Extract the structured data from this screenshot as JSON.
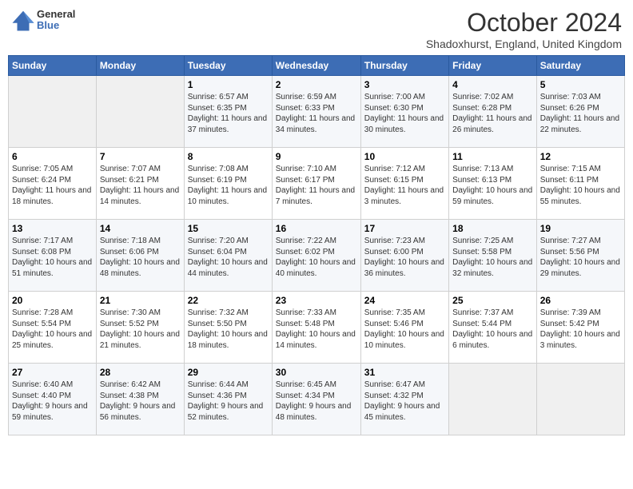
{
  "header": {
    "logo_line1": "General",
    "logo_line2": "Blue",
    "month": "October 2024",
    "location": "Shadoxhurst, England, United Kingdom"
  },
  "days_of_week": [
    "Sunday",
    "Monday",
    "Tuesday",
    "Wednesday",
    "Thursday",
    "Friday",
    "Saturday"
  ],
  "weeks": [
    [
      {
        "day": null,
        "content": ""
      },
      {
        "day": null,
        "content": ""
      },
      {
        "day": 1,
        "content": "Sunrise: 6:57 AM\nSunset: 6:35 PM\nDaylight: 11 hours and 37 minutes."
      },
      {
        "day": 2,
        "content": "Sunrise: 6:59 AM\nSunset: 6:33 PM\nDaylight: 11 hours and 34 minutes."
      },
      {
        "day": 3,
        "content": "Sunrise: 7:00 AM\nSunset: 6:30 PM\nDaylight: 11 hours and 30 minutes."
      },
      {
        "day": 4,
        "content": "Sunrise: 7:02 AM\nSunset: 6:28 PM\nDaylight: 11 hours and 26 minutes."
      },
      {
        "day": 5,
        "content": "Sunrise: 7:03 AM\nSunset: 6:26 PM\nDaylight: 11 hours and 22 minutes."
      }
    ],
    [
      {
        "day": 6,
        "content": "Sunrise: 7:05 AM\nSunset: 6:24 PM\nDaylight: 11 hours and 18 minutes."
      },
      {
        "day": 7,
        "content": "Sunrise: 7:07 AM\nSunset: 6:21 PM\nDaylight: 11 hours and 14 minutes."
      },
      {
        "day": 8,
        "content": "Sunrise: 7:08 AM\nSunset: 6:19 PM\nDaylight: 11 hours and 10 minutes."
      },
      {
        "day": 9,
        "content": "Sunrise: 7:10 AM\nSunset: 6:17 PM\nDaylight: 11 hours and 7 minutes."
      },
      {
        "day": 10,
        "content": "Sunrise: 7:12 AM\nSunset: 6:15 PM\nDaylight: 11 hours and 3 minutes."
      },
      {
        "day": 11,
        "content": "Sunrise: 7:13 AM\nSunset: 6:13 PM\nDaylight: 10 hours and 59 minutes."
      },
      {
        "day": 12,
        "content": "Sunrise: 7:15 AM\nSunset: 6:11 PM\nDaylight: 10 hours and 55 minutes."
      }
    ],
    [
      {
        "day": 13,
        "content": "Sunrise: 7:17 AM\nSunset: 6:08 PM\nDaylight: 10 hours and 51 minutes."
      },
      {
        "day": 14,
        "content": "Sunrise: 7:18 AM\nSunset: 6:06 PM\nDaylight: 10 hours and 48 minutes."
      },
      {
        "day": 15,
        "content": "Sunrise: 7:20 AM\nSunset: 6:04 PM\nDaylight: 10 hours and 44 minutes."
      },
      {
        "day": 16,
        "content": "Sunrise: 7:22 AM\nSunset: 6:02 PM\nDaylight: 10 hours and 40 minutes."
      },
      {
        "day": 17,
        "content": "Sunrise: 7:23 AM\nSunset: 6:00 PM\nDaylight: 10 hours and 36 minutes."
      },
      {
        "day": 18,
        "content": "Sunrise: 7:25 AM\nSunset: 5:58 PM\nDaylight: 10 hours and 32 minutes."
      },
      {
        "day": 19,
        "content": "Sunrise: 7:27 AM\nSunset: 5:56 PM\nDaylight: 10 hours and 29 minutes."
      }
    ],
    [
      {
        "day": 20,
        "content": "Sunrise: 7:28 AM\nSunset: 5:54 PM\nDaylight: 10 hours and 25 minutes."
      },
      {
        "day": 21,
        "content": "Sunrise: 7:30 AM\nSunset: 5:52 PM\nDaylight: 10 hours and 21 minutes."
      },
      {
        "day": 22,
        "content": "Sunrise: 7:32 AM\nSunset: 5:50 PM\nDaylight: 10 hours and 18 minutes."
      },
      {
        "day": 23,
        "content": "Sunrise: 7:33 AM\nSunset: 5:48 PM\nDaylight: 10 hours and 14 minutes."
      },
      {
        "day": 24,
        "content": "Sunrise: 7:35 AM\nSunset: 5:46 PM\nDaylight: 10 hours and 10 minutes."
      },
      {
        "day": 25,
        "content": "Sunrise: 7:37 AM\nSunset: 5:44 PM\nDaylight: 10 hours and 6 minutes."
      },
      {
        "day": 26,
        "content": "Sunrise: 7:39 AM\nSunset: 5:42 PM\nDaylight: 10 hours and 3 minutes."
      }
    ],
    [
      {
        "day": 27,
        "content": "Sunrise: 6:40 AM\nSunset: 4:40 PM\nDaylight: 9 hours and 59 minutes."
      },
      {
        "day": 28,
        "content": "Sunrise: 6:42 AM\nSunset: 4:38 PM\nDaylight: 9 hours and 56 minutes."
      },
      {
        "day": 29,
        "content": "Sunrise: 6:44 AM\nSunset: 4:36 PM\nDaylight: 9 hours and 52 minutes."
      },
      {
        "day": 30,
        "content": "Sunrise: 6:45 AM\nSunset: 4:34 PM\nDaylight: 9 hours and 48 minutes."
      },
      {
        "day": 31,
        "content": "Sunrise: 6:47 AM\nSunset: 4:32 PM\nDaylight: 9 hours and 45 minutes."
      },
      {
        "day": null,
        "content": ""
      },
      {
        "day": null,
        "content": ""
      }
    ]
  ]
}
